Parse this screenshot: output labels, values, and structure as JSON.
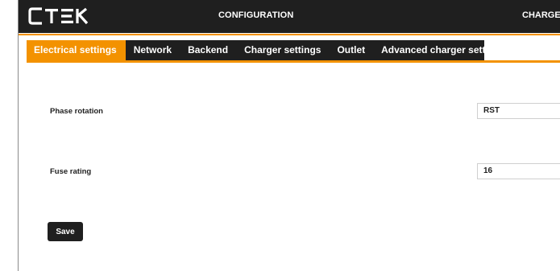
{
  "header": {
    "logo_text": "CTEK",
    "nav_configuration": "CONFIGURATION",
    "nav_charger": "CHARGEE"
  },
  "tabs": [
    {
      "label": "Electrical settings",
      "active": true
    },
    {
      "label": "Network",
      "active": false
    },
    {
      "label": "Backend",
      "active": false
    },
    {
      "label": "Charger settings",
      "active": false
    },
    {
      "label": "Outlet",
      "active": false
    },
    {
      "label": "Advanced charger settings",
      "active": false
    }
  ],
  "form": {
    "phase_rotation": {
      "label": "Phase rotation",
      "value": "RST"
    },
    "fuse_rating": {
      "label": "Fuse rating",
      "value": "16"
    },
    "save_label": "Save"
  },
  "colors": {
    "accent": "#f39200",
    "dark": "#1f1f1f",
    "background": "#ffffff"
  }
}
